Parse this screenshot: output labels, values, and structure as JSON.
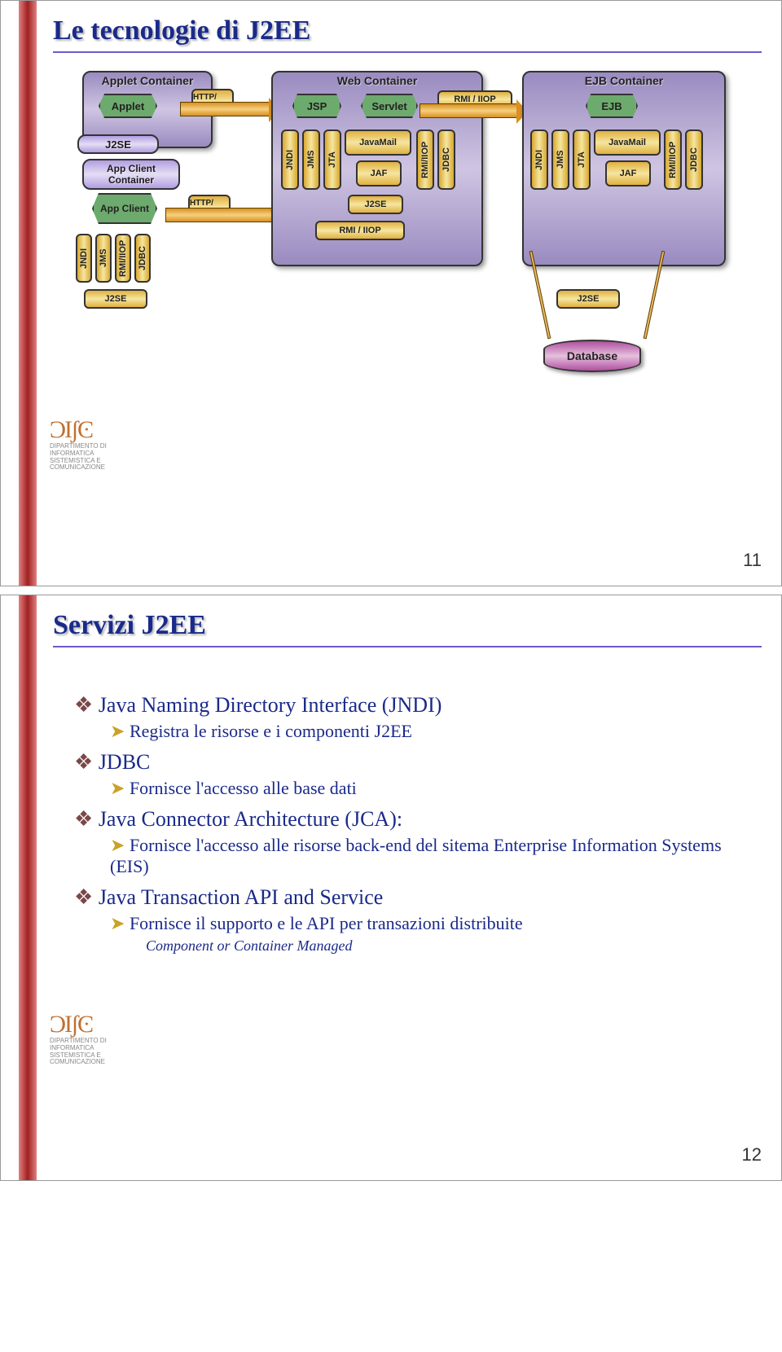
{
  "slide1": {
    "title": "Le tecnologie di J2EE",
    "pageNum": "11",
    "logo": {
      "swirl": "ϽIʃϾ",
      "text": "DIPARTIMENTO DI INFORMATICA SISTEMISTICA E COMUNICAZIONE"
    },
    "diagram": {
      "appletContainer": "Applet Container",
      "applet": "Applet",
      "j2se": "J2SE",
      "appClientContainer": "App Client Container",
      "appClient": "App Client",
      "httpHttps": "HTTP/ HTTPS",
      "webContainer": "Web Container",
      "jsp": "JSP",
      "servlet": "Servlet",
      "rmiIiop": "RMI / IIOP",
      "ejbContainer": "EJB Container",
      "ejb": "EJB",
      "jndi": "JNDI",
      "jms": "JMS",
      "jta": "JTA",
      "javamail": "JavaMail",
      "jaf": "JAF",
      "rmiIiopV": "RMI/IIOP",
      "jdbc": "JDBC",
      "database": "Database"
    }
  },
  "slide2": {
    "title": "Servizi J2EE",
    "pageNum": "12",
    "logo": {
      "swirl": "ϽIʃϾ",
      "text": "DIPARTIMENTO DI INFORMATICA SISTEMISTICA E COMUNICAZIONE"
    },
    "bullets": {
      "b1a": "Java Naming Directory Interface (JNDI)",
      "b2a": "Registra le risorse e i componenti J2EE",
      "b1b": "JDBC",
      "b2b": "Fornisce l'accesso alle base dati",
      "b1c": "Java Connector Architecture (JCA):",
      "b2c": "Fornisce l'accesso alle risorse back-end del sitema Enterprise Information Systems (EIS)",
      "b1d": "Java Transaction API and Service",
      "b2d": "Fornisce il supporto e le API per transazioni distribuite",
      "b3a": "Component or Container Managed"
    }
  }
}
